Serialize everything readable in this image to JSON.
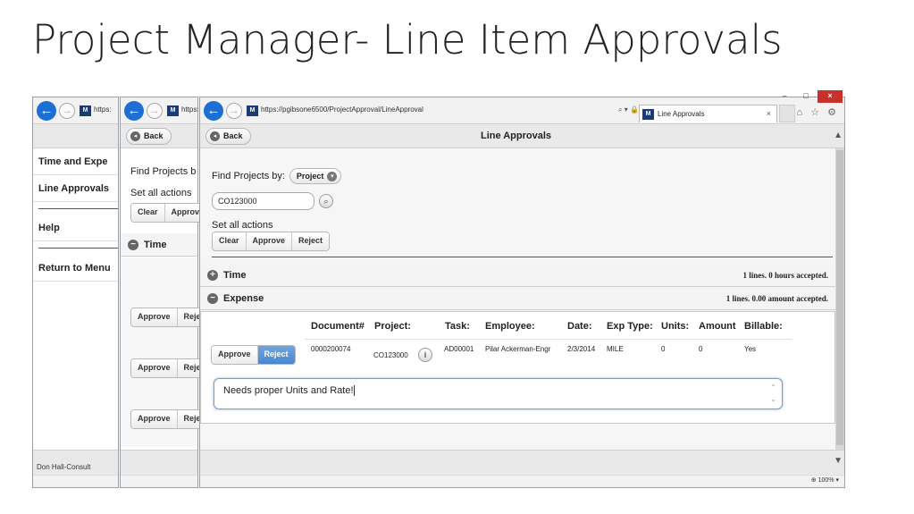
{
  "slide": {
    "title": "Project Manager- Line Item Approvals"
  },
  "window1": {
    "url": "https:",
    "nav": [
      {
        "label": "Time and Expe"
      },
      {
        "label": "Line Approvals"
      },
      {
        "label": "Help"
      },
      {
        "label": "Return to Menu"
      }
    ],
    "footer_user": "Don Hall-Consult"
  },
  "window2": {
    "url": "https:",
    "back_label": "Back",
    "find_text": "Find Projects b",
    "set_all_text": "Set all actions",
    "actions": [
      "Clear",
      "Approv"
    ],
    "time_section": "Time",
    "row_buttons": [
      "Approve",
      "Reje"
    ]
  },
  "main": {
    "url": "https://pgibsone6500/ProjectApproval/LineApproval",
    "search_controls": "⌕ ▾ 🔒 ↻",
    "tab_label": "Line Approvals",
    "tab_close": "×",
    "window_controls": [
      "–",
      "□",
      "×"
    ],
    "tool_icons": "⌂ ☆ ⚙",
    "back_label": "Back",
    "page_title": "Line Approvals",
    "find_label": "Find Projects by:",
    "find_by_value": "Project",
    "project_value": "CO123000",
    "set_all_label": "Set all actions",
    "actions": [
      "Clear",
      "Approve",
      "Reject"
    ],
    "sections": {
      "time": {
        "label": "Time",
        "summary": "1 lines. 0 hours accepted."
      },
      "expense": {
        "label": "Expense",
        "summary": "1 lines. 0.00 amount accepted."
      }
    },
    "table": {
      "headers": [
        "Document#",
        "Project:",
        "Task:",
        "Employee:",
        "Date:",
        "Exp Type:",
        "Units:",
        "Amount",
        "Billable:"
      ],
      "row": {
        "approve_label": "Approve",
        "reject_label": "Reject",
        "document": "0000200074",
        "project": "CO123000",
        "task": "AD00001",
        "employee": "Pilar Ackerman-Engr",
        "date": "2/3/2014",
        "exp_type": "MILE",
        "units": "0",
        "amount": "0",
        "billable": "Yes"
      }
    },
    "comment": "Needs proper Units and Rate!",
    "zoom": "100%"
  },
  "colors": {
    "accent_blue": "#1e6fd4",
    "reject_active": "#4a88cf",
    "close_red": "#c9302c"
  }
}
